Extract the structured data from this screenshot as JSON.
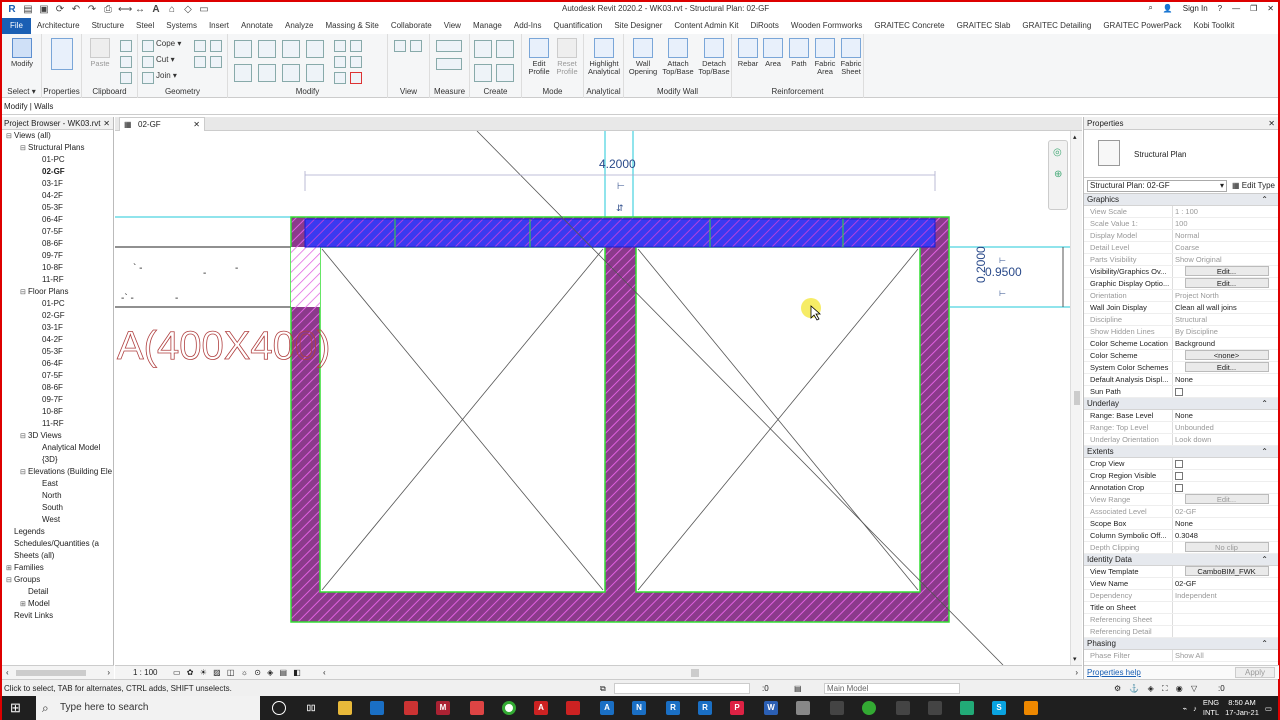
{
  "app": {
    "title": "Autodesk Revit 2020.2 - WK03.rvt - Structural Plan: 02-GF",
    "sign_in": "Sign In"
  },
  "menu": {
    "tabs": [
      "File",
      "Architecture",
      "Structure",
      "Steel",
      "Systems",
      "Insert",
      "Annotate",
      "Analyze",
      "Massing & Site",
      "Collaborate",
      "View",
      "Manage",
      "Add-Ins",
      "Quantification",
      "Site Designer",
      "Content Admin Kit",
      "DiRoots",
      "Wooden Formworks",
      "GRAITEC Concrete",
      "GRAITEC Slab",
      "GRAITEC Detailing",
      "GRAITEC PowerPack",
      "Kobi Toolkit"
    ]
  },
  "ribbon": {
    "modify": "Modify",
    "properties": "Properties",
    "paste": "Paste",
    "cope": "Cope",
    "cut": "Cut",
    "join": "Join",
    "panels": {
      "select": "Select",
      "properties": "Properties",
      "clipboard": "Clipboard",
      "geometry": "Geometry",
      "modify": "Modify",
      "view": "View",
      "measure": "Measure",
      "create": "Create",
      "mode": "Mode",
      "analytical": "Analytical",
      "modify_wall": "Modify Wall",
      "reinforcement": "Reinforcement"
    },
    "tools": {
      "edit_profile": "Edit Profile",
      "reset_profile": "Reset Profile",
      "highlight_analytical": "Highlight Analytical",
      "wall_opening": "Wall Opening",
      "attach_top_base": "Attach Top/Base",
      "detach_top_base": "Detach Top/Base",
      "rebar": "Rebar",
      "area": "Area",
      "path": "Path",
      "fabric_area": "Fabric Area",
      "fabric_sheet": "Fabric Sheet"
    }
  },
  "modeline": "Modify | Walls",
  "browser": {
    "title": "Project Browser - WK03.rvt",
    "tree": [
      {
        "label": "Views (all)",
        "level": 0,
        "toggle": "−"
      },
      {
        "label": "Structural Plans",
        "level": 1,
        "toggle": "−"
      },
      {
        "label": "01-PC",
        "level": 2
      },
      {
        "label": "02-GF",
        "level": 2,
        "selected": true
      },
      {
        "label": "03-1F",
        "level": 2
      },
      {
        "label": "04-2F",
        "level": 2
      },
      {
        "label": "05-3F",
        "level": 2
      },
      {
        "label": "06-4F",
        "level": 2
      },
      {
        "label": "07-5F",
        "level": 2
      },
      {
        "label": "08-6F",
        "level": 2
      },
      {
        "label": "09-7F",
        "level": 2
      },
      {
        "label": "10-8F",
        "level": 2
      },
      {
        "label": "11-RF",
        "level": 2
      },
      {
        "label": "Floor Plans",
        "level": 1,
        "toggle": "−"
      },
      {
        "label": "01-PC",
        "level": 2
      },
      {
        "label": "02-GF",
        "level": 2
      },
      {
        "label": "03-1F",
        "level": 2
      },
      {
        "label": "04-2F",
        "level": 2
      },
      {
        "label": "05-3F",
        "level": 2
      },
      {
        "label": "06-4F",
        "level": 2
      },
      {
        "label": "07-5F",
        "level": 2
      },
      {
        "label": "08-6F",
        "level": 2
      },
      {
        "label": "09-7F",
        "level": 2
      },
      {
        "label": "10-8F",
        "level": 2
      },
      {
        "label": "11-RF",
        "level": 2
      },
      {
        "label": "3D Views",
        "level": 1,
        "toggle": "−"
      },
      {
        "label": "Analytical Model",
        "level": 2
      },
      {
        "label": "{3D}",
        "level": 2
      },
      {
        "label": "Elevations (Building Ele",
        "level": 1,
        "toggle": "−"
      },
      {
        "label": "East",
        "level": 2
      },
      {
        "label": "North",
        "level": 2
      },
      {
        "label": "South",
        "level": 2
      },
      {
        "label": "West",
        "level": 2
      },
      {
        "label": "Legends",
        "level": 0
      },
      {
        "label": "Schedules/Quantities (a",
        "level": 0
      },
      {
        "label": "Sheets (all)",
        "level": 0
      },
      {
        "label": "Families",
        "level": 0,
        "toggle": "+"
      },
      {
        "label": "Groups",
        "level": 0,
        "toggle": "−"
      },
      {
        "label": "Detail",
        "level": 1
      },
      {
        "label": "Model",
        "level": 1,
        "toggle": "+"
      },
      {
        "label": "Revit Links",
        "level": 0
      }
    ]
  },
  "view": {
    "tab": "02-GF",
    "dim_top": "4.2000",
    "dim_right_a": "0.2000",
    "dim_right_b": "0.9500",
    "tag_text": "A(400X400)",
    "scale": "1 : 100"
  },
  "properties": {
    "title": "Properties",
    "type_name": "Structural Plan",
    "instance": "Structural Plan: 02-GF",
    "edit_type": "Edit Type",
    "groups": [
      {
        "name": "Graphics",
        "rows": [
          {
            "k": "View Scale",
            "v": "1 : 100",
            "dis": true
          },
          {
            "k": "Scale Value    1:",
            "v": "100",
            "dis": true
          },
          {
            "k": "Display Model",
            "v": "Normal",
            "dis": true
          },
          {
            "k": "Detail Level",
            "v": "Coarse",
            "dis": true
          },
          {
            "k": "Parts Visibility",
            "v": "Show Original",
            "dis": true
          },
          {
            "k": "Visibility/Graphics Ov...",
            "v": "Edit...",
            "btn": true
          },
          {
            "k": "Graphic Display Optio...",
            "v": "Edit...",
            "btn": true
          },
          {
            "k": "Orientation",
            "v": "Project North",
            "dis": true
          },
          {
            "k": "Wall Join Display",
            "v": "Clean all wall joins"
          },
          {
            "k": "Discipline",
            "v": "Structural",
            "dis": true
          },
          {
            "k": "Show Hidden Lines",
            "v": "By Discipline",
            "dis": true
          },
          {
            "k": "Color Scheme Location",
            "v": "Background"
          },
          {
            "k": "Color Scheme",
            "v": "<none>",
            "btn": true
          },
          {
            "k": "System Color Schemes",
            "v": "Edit...",
            "btn": true
          },
          {
            "k": "Default Analysis Displ...",
            "v": "None"
          },
          {
            "k": "Sun Path",
            "v": "",
            "check": true
          }
        ]
      },
      {
        "name": "Underlay",
        "rows": [
          {
            "k": "Range: Base Level",
            "v": "None"
          },
          {
            "k": "Range: Top Level",
            "v": "Unbounded",
            "dis": true
          },
          {
            "k": "Underlay Orientation",
            "v": "Look down",
            "dis": true
          }
        ]
      },
      {
        "name": "Extents",
        "rows": [
          {
            "k": "Crop View",
            "v": "",
            "check": true
          },
          {
            "k": "Crop Region Visible",
            "v": "",
            "check": true
          },
          {
            "k": "Annotation Crop",
            "v": "",
            "check": true
          },
          {
            "k": "View Range",
            "v": "Edit...",
            "btn": true,
            "dis": true
          },
          {
            "k": "Associated Level",
            "v": "02-GF",
            "dis": true
          },
          {
            "k": "Scope Box",
            "v": "None"
          },
          {
            "k": "Column Symbolic Off...",
            "v": "0.3048"
          },
          {
            "k": "Depth Clipping",
            "v": "No clip",
            "btn": true,
            "dis": true
          }
        ]
      },
      {
        "name": "Identity Data",
        "rows": [
          {
            "k": "View Template",
            "v": "CamboBIM_FWK",
            "btn": true
          },
          {
            "k": "View Name",
            "v": "02-GF"
          },
          {
            "k": "Dependency",
            "v": "Independent",
            "dis": true
          },
          {
            "k": "Title on Sheet",
            "v": ""
          },
          {
            "k": "Referencing Sheet",
            "v": "",
            "dis": true
          },
          {
            "k": "Referencing Detail",
            "v": "",
            "dis": true
          }
        ]
      },
      {
        "name": "Phasing",
        "rows": [
          {
            "k": "Phase Filter",
            "v": "Show All",
            "dis": true
          }
        ]
      }
    ],
    "help": "Properties help",
    "apply": "Apply"
  },
  "status": {
    "hint": "Click to select, TAB for alternates, CTRL adds, SHIFT unselects.",
    "workset": "Main Model",
    "zero": ":0",
    "filter_count": ":0"
  },
  "taskbar": {
    "search_placeholder": "Type here to search",
    "lang1": "ENG",
    "lang2": "INTL",
    "time": "8:50 AM",
    "date": "17-Jan-21"
  },
  "colors": {
    "wall_hatch": "#8b3a8b",
    "wall_hatch_line": "#e060e0",
    "beam_blue": "#3a3af0",
    "selection_green": "#33dd33",
    "ref_cyan": "#22c8d8",
    "file_tab": "#1a5fb4"
  }
}
